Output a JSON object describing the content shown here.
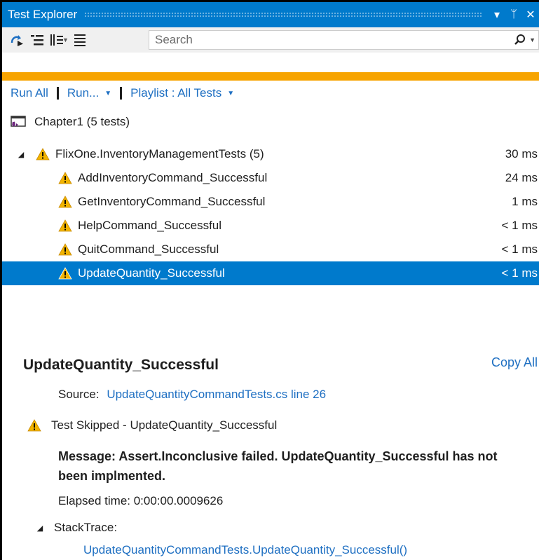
{
  "window": {
    "title": "Test Explorer",
    "pin_glyph": "ᛘ",
    "close_glyph": "✕",
    "menu_glyph": "▾"
  },
  "toolbar": {
    "search_placeholder": "Search"
  },
  "commands": {
    "run_all": "Run All",
    "run": "Run...",
    "playlist": "Playlist : All Tests"
  },
  "project": {
    "label": "Chapter1 (5 tests)"
  },
  "tree": {
    "group": {
      "label": "FlixOne.InventoryManagementTests (5)",
      "time": "30 ms"
    },
    "tests": [
      {
        "label": "AddInventoryCommand_Successful",
        "time": "24 ms"
      },
      {
        "label": "GetInventoryCommand_Successful",
        "time": "1 ms"
      },
      {
        "label": "HelpCommand_Successful",
        "time": "< 1 ms"
      },
      {
        "label": "QuitCommand_Successful",
        "time": "< 1 ms"
      },
      {
        "label": "UpdateQuantity_Successful",
        "time": "< 1 ms"
      }
    ]
  },
  "details": {
    "title": "UpdateQuantity_Successful",
    "copy_all": "Copy All",
    "source_label": "Source:",
    "source_link": "UpdateQuantityCommandTests.cs line 26",
    "skipped": "Test Skipped - UpdateQuantity_Successful",
    "message": "Message: Assert.Inconclusive failed. UpdateQuantity_Successful has not been implmented.",
    "elapsed": "Elapsed time: 0:00:00.0009626",
    "stacktrace_label": "StackTrace:",
    "stacktrace_line": "UpdateQuantityCommandTests.UpdateQuantity_Successful()"
  },
  "colors": {
    "accent": "#007acc",
    "progress": "#f7a400",
    "link": "#1e6fc2",
    "warning": "#f2b400"
  }
}
